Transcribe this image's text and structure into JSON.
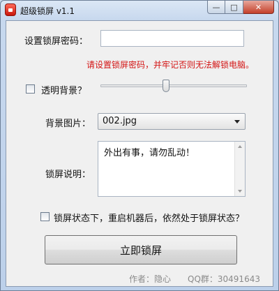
{
  "window": {
    "title": "超级锁屏 v1.1",
    "minimize": "—",
    "maximize": "□",
    "close": "✕"
  },
  "form": {
    "password_label": "设置锁屏密码：",
    "password_value": "",
    "warning": "请设置锁屏密码，并牢记否则无法解锁电脑。",
    "transparent_label": "透明背景？",
    "transparent_checked": false,
    "bg_image_label": "背景图片：",
    "bg_image_value": "002.jpg",
    "lock_note_label": "锁屏说明：",
    "lock_note_value": "外出有事，请勿乱动！",
    "reboot_label": "锁屏状态下，重启机器后，依然处于锁屏状态？",
    "reboot_checked": false,
    "lock_button": "立即锁屏"
  },
  "footer": {
    "author": "作者：隐心",
    "qq": "QQ群：30491643"
  },
  "colors": {
    "warning": "#d31515",
    "window_bg": "#f0f0f0",
    "title_gradient_top": "#dbe7f5"
  },
  "icons": [
    "lock-app-icon",
    "minimize-icon",
    "maximize-icon",
    "close-icon",
    "dropdown-arrow-icon"
  ]
}
